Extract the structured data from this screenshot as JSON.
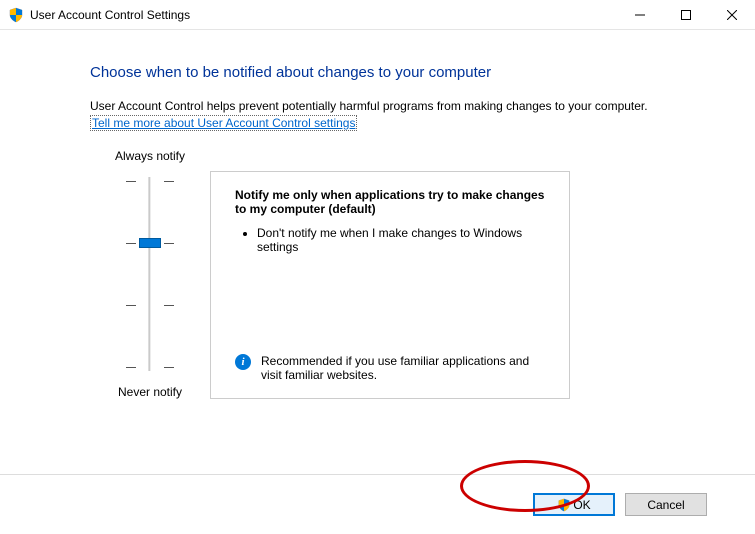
{
  "window": {
    "title": "User Account Control Settings"
  },
  "heading": "Choose when to be notified about changes to your computer",
  "description": "User Account Control helps prevent potentially harmful programs from making changes to your computer.",
  "link_text": "Tell me more about User Account Control settings",
  "slider": {
    "top_label": "Always notify",
    "bottom_label": "Never notify",
    "levels": 4,
    "selected_index": 1
  },
  "panel": {
    "title": "Notify me only when applications try to make changes to my computer (default)",
    "bullets": [
      "Don't notify me when I make changes to Windows settings"
    ],
    "footer": "Recommended if you use familiar applications and visit familiar websites."
  },
  "buttons": {
    "ok": "OK",
    "cancel": "Cancel"
  }
}
